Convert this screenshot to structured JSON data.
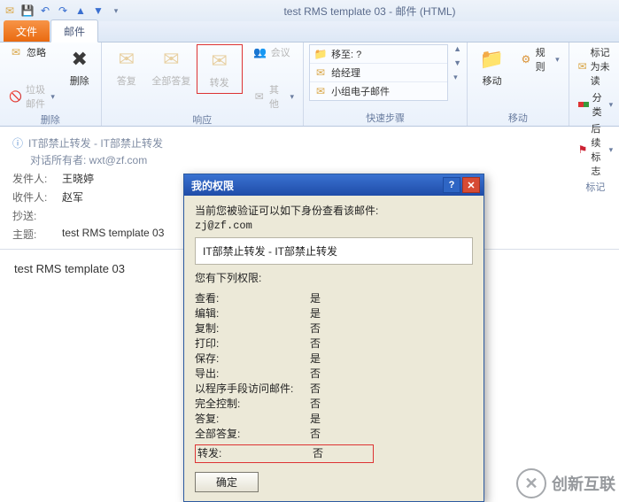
{
  "window": {
    "title": "test RMS template 03 - 邮件 (HTML)"
  },
  "tabs": {
    "file": "文件",
    "mail": "邮件"
  },
  "ribbon": {
    "delete": {
      "ignore": "忽略",
      "junk": "垃圾邮件",
      "del": "删除",
      "label": "删除"
    },
    "respond": {
      "reply": "答复",
      "replyAll": "全部答复",
      "forward": "转发",
      "meeting": "会议",
      "other": "其他",
      "label": "响应"
    },
    "quick": {
      "moveTo": "移至: ?",
      "toManager": "给经理",
      "teamMail": "小组电子邮件",
      "label": "快速步骤"
    },
    "move": {
      "move": "移动",
      "rules": "规则",
      "label": "移动"
    },
    "tags": {
      "markUnread": "标记为未读",
      "categorize": "分类",
      "followUp": "后续标志",
      "label": "标记"
    }
  },
  "mail": {
    "info1": "IT部禁止转发 - IT部禁止转发",
    "info2": "对话所有者: wxt@zf.com",
    "lbl_from": "发件人:",
    "lbl_to": "收件人:",
    "lbl_cc": "抄送:",
    "lbl_subject": "主题:",
    "from": "王晓婷",
    "to": "赵军",
    "cc": "",
    "subject": "test RMS template 03",
    "body": "test RMS template 03"
  },
  "dialog": {
    "title": "我的权限",
    "line1": "当前您被验证可以如下身份查看该邮件:",
    "identity": "zj@zf.com",
    "restriction": "IT部禁止转发 - IT部禁止转发",
    "permsHeader": "您有下列权限:",
    "perms": [
      {
        "k": "查看:",
        "v": "是"
      },
      {
        "k": "编辑:",
        "v": "是"
      },
      {
        "k": "复制:",
        "v": "否"
      },
      {
        "k": "打印:",
        "v": "否"
      },
      {
        "k": "保存:",
        "v": "是"
      },
      {
        "k": "导出:",
        "v": "否"
      },
      {
        "k": "以程序手段访问邮件:",
        "v": "否"
      },
      {
        "k": "完全控制:",
        "v": "否"
      },
      {
        "k": "答复:",
        "v": "是"
      },
      {
        "k": "全部答复:",
        "v": "否"
      },
      {
        "k": "转发:",
        "v": "否"
      }
    ],
    "ok": "确定"
  },
  "watermark": "创新互联"
}
